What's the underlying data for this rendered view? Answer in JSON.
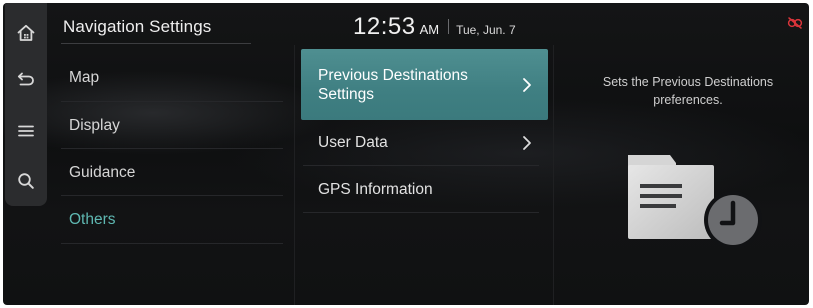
{
  "header": {
    "title": "Navigation Settings",
    "time": "12:53",
    "ampm": "AM",
    "date": "Tue, Jun. 7"
  },
  "rail": {
    "icons": [
      "home-icon",
      "back-icon",
      "menu-icon",
      "search-icon"
    ]
  },
  "menu": {
    "items": [
      {
        "label": "Map"
      },
      {
        "label": "Display"
      },
      {
        "label": "Guidance"
      },
      {
        "label": "Others"
      }
    ],
    "active": "Others"
  },
  "submenu": {
    "items": [
      {
        "label_line1": "Previous Destinations",
        "label_line2": "Settings",
        "chevron": true
      },
      {
        "label": "User Data",
        "chevron": true
      },
      {
        "label": "GPS Information",
        "chevron": false
      }
    ],
    "selected": "Previous Destinations Settings"
  },
  "description": {
    "line1": "Sets the Previous Destinations",
    "line2": "preferences."
  },
  "colors": {
    "accent": "#5fb8b2",
    "selected_bg": "#4a8a8c",
    "status_red": "#d8343a"
  },
  "status": {
    "icon": "link-off-icon"
  }
}
